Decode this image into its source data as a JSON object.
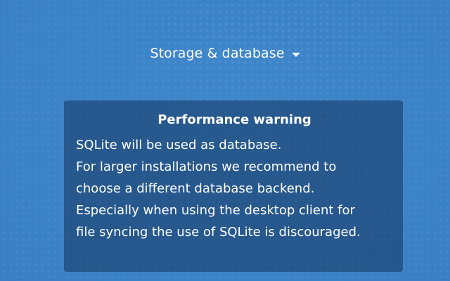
{
  "section": {
    "title": "Storage & database",
    "caret_icon": "caret-down-icon"
  },
  "warning": {
    "title": "Performance warning",
    "lines": [
      "SQLite will be used as database.",
      "For larger installations we recommend to",
      "choose a different database backend.",
      "Especially when using the desktop client for",
      "file syncing the use of SQLite is discouraged."
    ]
  },
  "colors": {
    "background": "#3d84c9",
    "warning_background": "#22507e",
    "text": "#ffffff"
  }
}
